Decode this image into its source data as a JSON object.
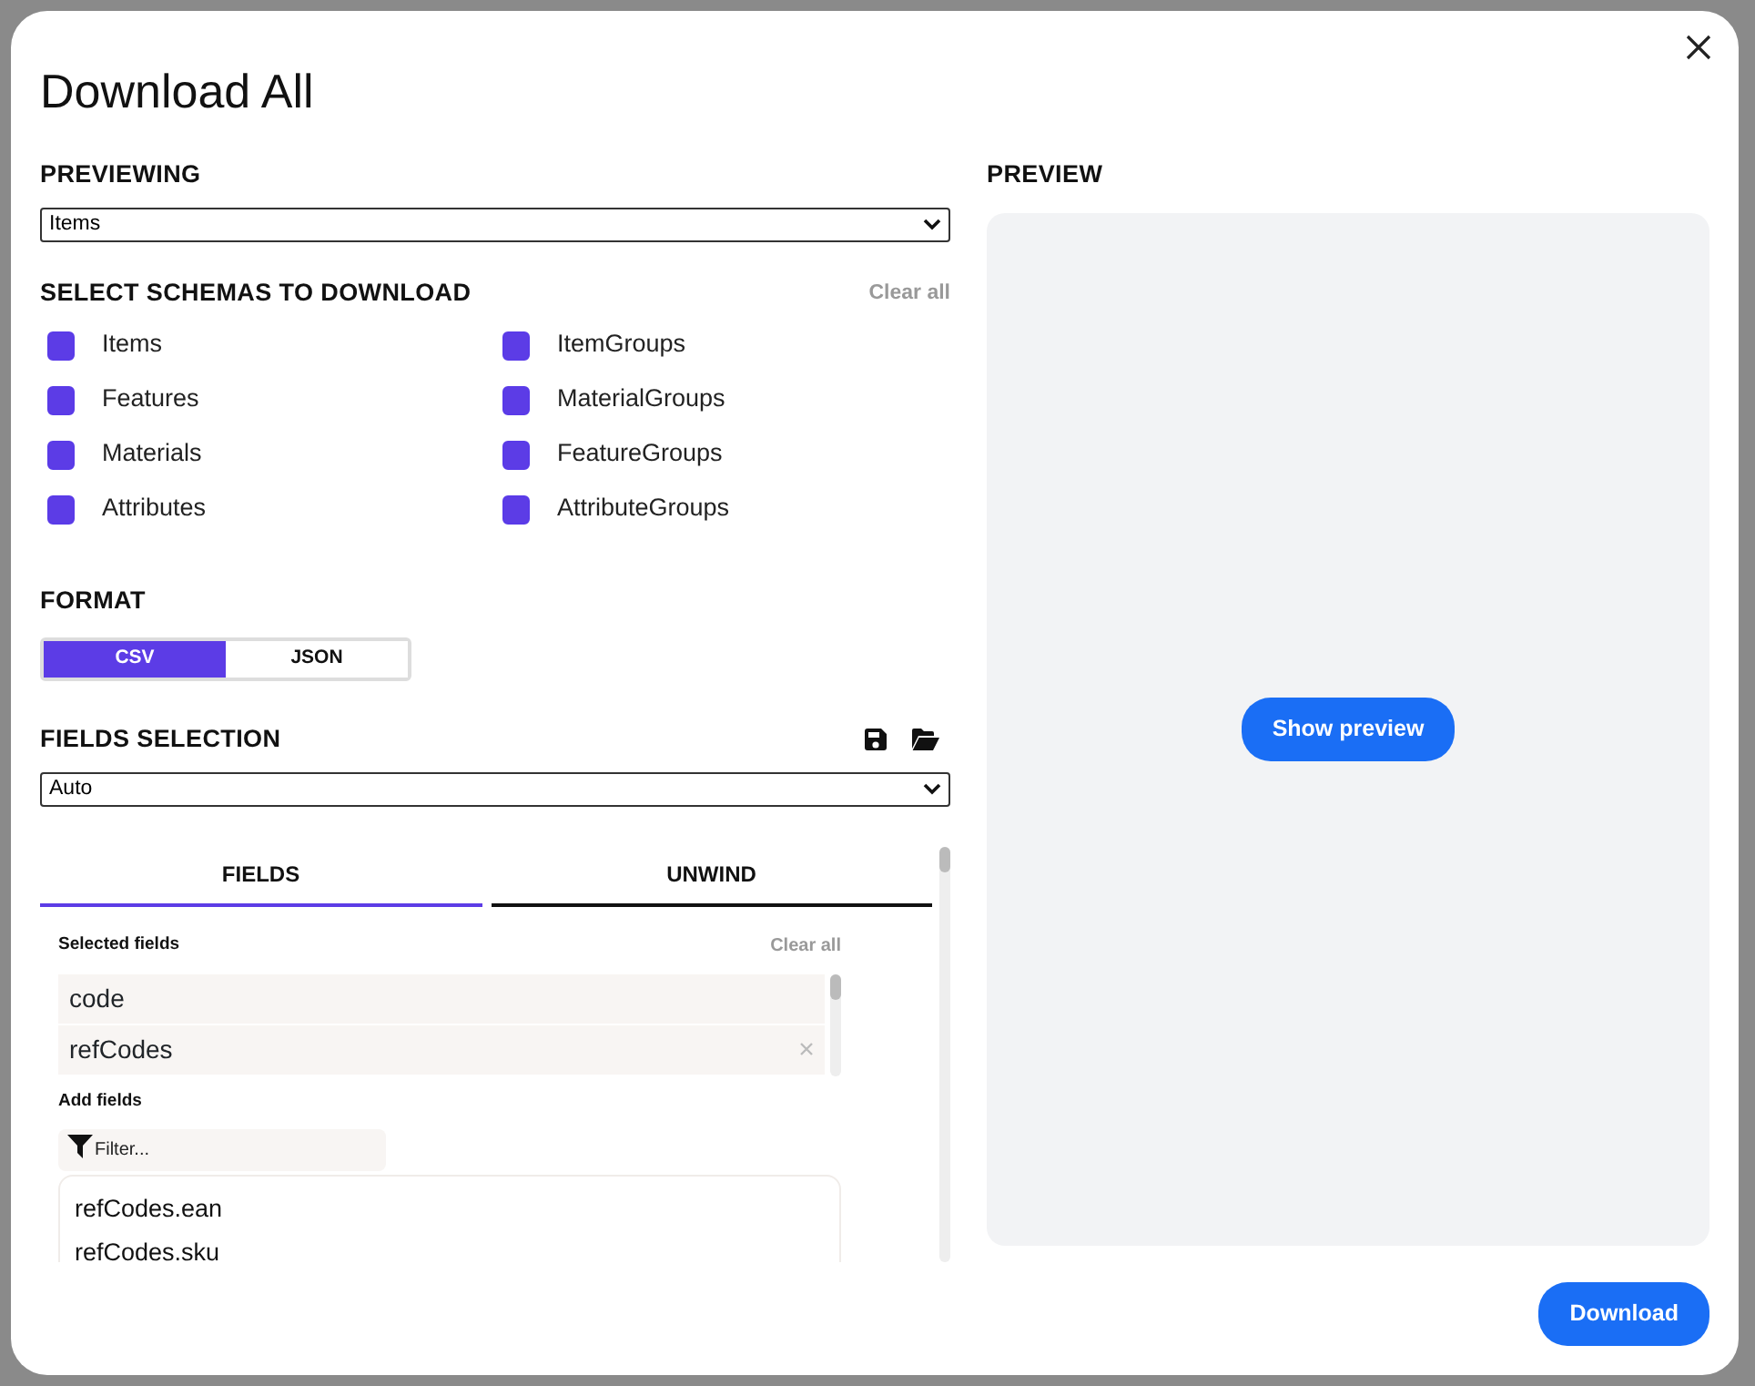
{
  "dialog": {
    "title": "Download All"
  },
  "previewing": {
    "label": "PREVIEWING",
    "value": "Items"
  },
  "schemas": {
    "label": "SELECT SCHEMAS TO DOWNLOAD",
    "clear": "Clear all",
    "items": [
      {
        "label": "Items",
        "checked": true
      },
      {
        "label": "ItemGroups",
        "checked": true
      },
      {
        "label": "Features",
        "checked": true
      },
      {
        "label": "MaterialGroups",
        "checked": true
      },
      {
        "label": "Materials",
        "checked": true
      },
      {
        "label": "FeatureGroups",
        "checked": true
      },
      {
        "label": "Attributes",
        "checked": true
      },
      {
        "label": "AttributeGroups",
        "checked": true
      }
    ]
  },
  "format": {
    "label": "FORMAT",
    "options": [
      {
        "label": "CSV",
        "selected": true
      },
      {
        "label": "JSON",
        "selected": false
      }
    ]
  },
  "fields_selection": {
    "label": "FIELDS SELECTION",
    "value": "Auto"
  },
  "tabs": [
    {
      "label": "FIELDS",
      "selected": true
    },
    {
      "label": "UNWIND",
      "selected": false
    }
  ],
  "selected_fields": {
    "label": "Selected fields",
    "clear": "Clear all",
    "items": [
      {
        "label": "code",
        "hovered": false
      },
      {
        "label": "refCodes",
        "hovered": true
      }
    ]
  },
  "add_fields": {
    "label": "Add fields",
    "placeholder": "Filter...",
    "items": [
      "refCodes.ean",
      "refCodes.sku"
    ]
  },
  "preview": {
    "label": "PREVIEW",
    "button": "Show preview"
  },
  "download": "Download"
}
